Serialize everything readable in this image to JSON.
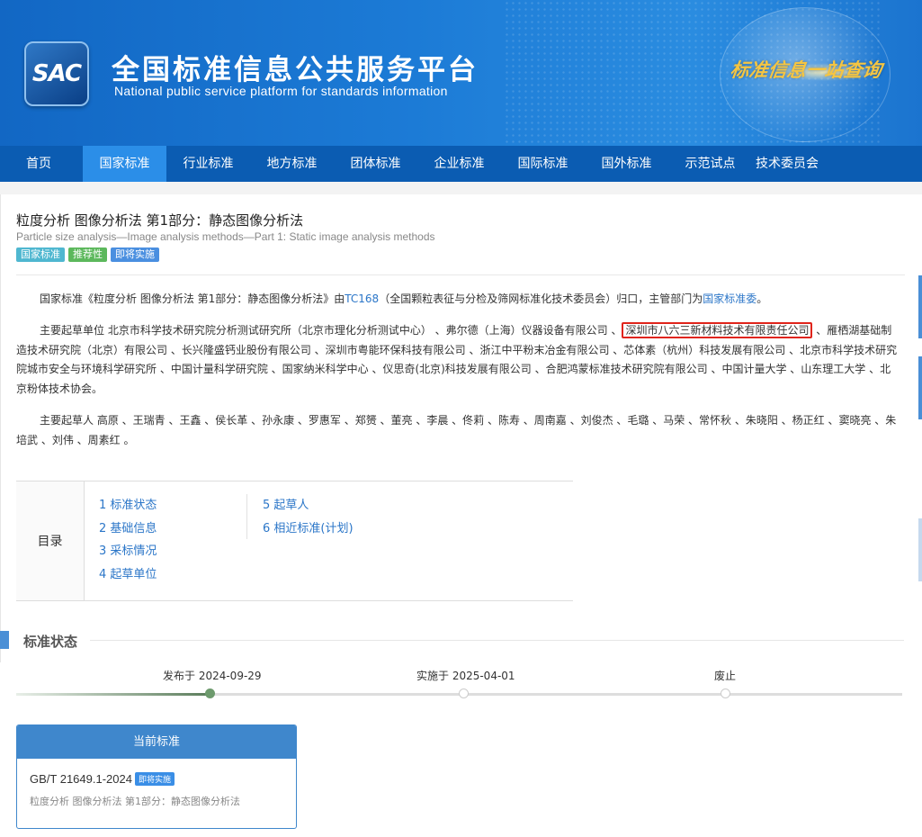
{
  "header": {
    "logo_text": "SAC",
    "title": "全国标准信息公共服务平台",
    "subtitle": "National public service platform  for standards information",
    "slogan": "标准信息一站查询"
  },
  "nav": [
    {
      "label": "首页",
      "active": false
    },
    {
      "label": "国家标准",
      "active": true
    },
    {
      "label": "行业标准",
      "active": false
    },
    {
      "label": "地方标准",
      "active": false
    },
    {
      "label": "团体标准",
      "active": false
    },
    {
      "label": "企业标准",
      "active": false
    },
    {
      "label": "国际标准",
      "active": false
    },
    {
      "label": "国外标准",
      "active": false
    },
    {
      "label": "示范试点",
      "active": false
    },
    {
      "label": "技术委员会",
      "active": false
    }
  ],
  "standard": {
    "title": "粒度分析 图像分析法 第1部分：静态图像分析法",
    "title_en": "Particle size analysis—Image analysis methods—Part 1: Static image analysis methods",
    "tags": [
      "国家标准",
      "推荐性",
      "即将实施"
    ]
  },
  "intro": {
    "text_before": "国家标准《粒度分析 图像分析法 第1部分：静态图像分析法》由",
    "tc_link": "TC168",
    "text_mid": "（全国颗粒表征与分检及筛网标准化技术委员会）归口，主管部门为",
    "dept_link": "国家标准委",
    "text_after": "。"
  },
  "drafting_units": {
    "prefix": "主要起草单位 北京市科学技术研究院分析测试研究所（北京市理化分析测试中心） 、弗尔德（上海）仪器设备有限公司 、",
    "highlighted": "深圳市八六三新材料技术有限责任公司",
    "suffix": " 、雁栖湖基础制造技术研究院（北京）有限公司 、长兴隆盛钙业股份有限公司 、深圳市粤能环保科技有限公司 、浙江中平粉末冶金有限公司 、芯体素（杭州）科技发展有限公司 、北京市科学技术研究院城市安全与环境科学研究所 、中国计量科学研究院 、国家纳米科学中心 、仪思奇(北京)科技发展有限公司 、合肥鸿蒙标准技术研究院有限公司 、中国计量大学 、山东理工大学 、北京粉体技术协会。"
  },
  "drafters": "主要起草人 高原 、王瑞青 、王鑫 、侯长革 、孙永康 、罗惠军 、郑赟 、董亮 、李晨 、佟莉 、陈寿 、周南嘉 、刘俊杰 、毛璐 、马荣 、常怀秋 、朱晓阳 、杨正红 、窦晓亮 、朱培武 、刘伟 、周素红 。",
  "toc": {
    "label": "目录",
    "col1": [
      "1  标准状态",
      "2  基础信息",
      "3  采标情况",
      "4  起草单位"
    ],
    "col2": [
      "5  起草人",
      "6  相近标准(计划)"
    ]
  },
  "status": {
    "section_title": "标准状态",
    "published": "发布于 2024-09-29",
    "implemented": "实施于 2025-04-01",
    "abolished": "废止"
  },
  "current": {
    "header": "当前标准",
    "code": "GB/T 21649.1-2024",
    "badge": "即将实施",
    "name": "粒度分析 图像分析法 第1部分：静态图像分析法"
  }
}
